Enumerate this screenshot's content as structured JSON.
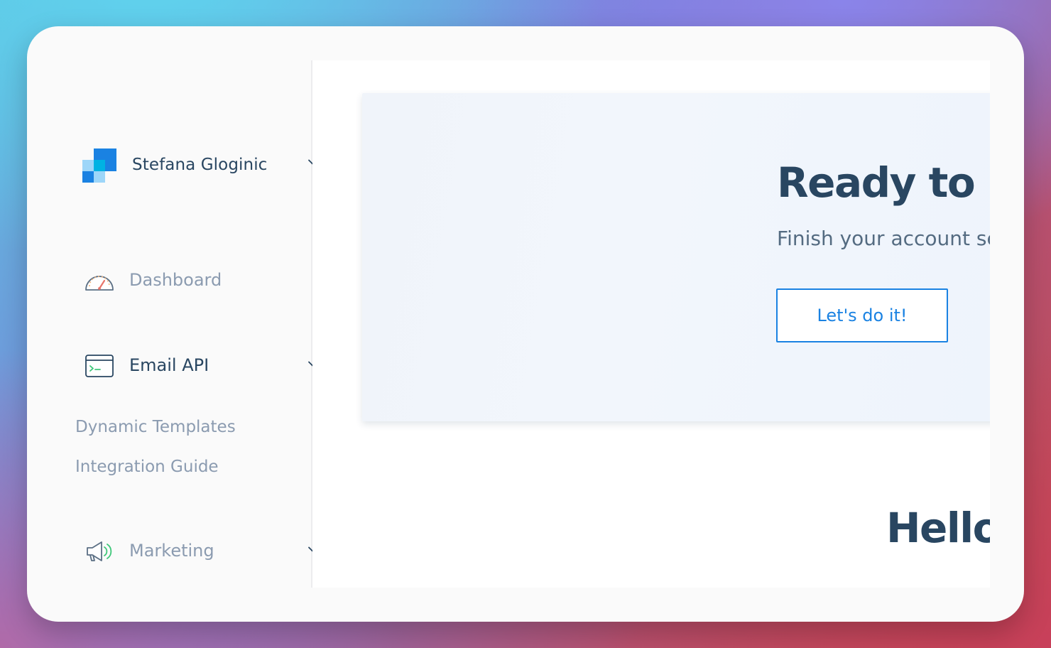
{
  "account": {
    "name": "Stefana Gloginic"
  },
  "nav": {
    "dashboard": "Dashboard",
    "email_api": "Email API",
    "email_api_sub": [
      "Dynamic Templates",
      "Integration Guide"
    ],
    "marketing": "Marketing"
  },
  "hero": {
    "title": "Ready to un",
    "subtitle": "Finish your account se",
    "button": "Let's do it!"
  },
  "greeting": "Hello",
  "colors": {
    "brand_blue": "#1a82e2",
    "navy_text": "#294661",
    "muted_text": "#8b9bb0"
  },
  "icons": [
    "logo-icon",
    "chevron-down-icon",
    "dashboard-gauge-icon",
    "terminal-window-icon",
    "megaphone-icon"
  ]
}
